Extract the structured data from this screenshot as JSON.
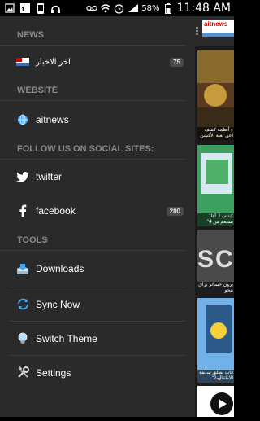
{
  "status_bar": {
    "battery_percent": "58%",
    "time": "11:48 AM",
    "left_icons": [
      "image-icon",
      "ait-icon",
      "phone-icon",
      "headphones-icon"
    ],
    "right_icons": [
      "voicemail-icon",
      "wifi-icon",
      "alarm-icon",
      "signal-icon",
      "battery-icon"
    ]
  },
  "drawer": {
    "sections": [
      {
        "header": "NEWS",
        "items": [
          {
            "label": "اخر الاخبار",
            "icon": "aitnews-logo-icon",
            "badge": "75"
          }
        ]
      },
      {
        "header": "WEBSITE",
        "items": [
          {
            "label": "aitnews",
            "icon": "globe-icon",
            "badge": ""
          }
        ]
      },
      {
        "header": "FOLLOW US ON SOCIAL SITES:",
        "items": [
          {
            "label": "twitter",
            "icon": "twitter-icon",
            "badge": ""
          },
          {
            "label": "facebook",
            "icon": "facebook-icon",
            "badge": "200"
          }
        ]
      },
      {
        "header": "TOOLS",
        "items": [
          {
            "label": "Downloads",
            "icon": "downloads-icon",
            "badge": ""
          },
          {
            "label": "Sync Now",
            "icon": "sync-icon",
            "badge": ""
          },
          {
            "label": "Switch Theme",
            "icon": "lightbulb-icon",
            "badge": ""
          },
          {
            "label": "Settings",
            "icon": "settings-icon",
            "badge": ""
          }
        ]
      }
    ]
  },
  "content": {
    "logo_text": "aitnews",
    "cards": [
      {
        "caption": "ء أنظمة كشف اعن لعبة الأكشن"
      },
      {
        "caption": "كشف ا. أقا\" يستعم س 4\""
      },
      {
        "caption": "يرون خسائر براق بنحو"
      },
      {
        "caption": "قات تطلق سابقة الأطفال 2\""
      }
    ]
  },
  "colors": {
    "drawer_bg": "#2a2a2a",
    "header_text": "#8a8a8a",
    "accent_blue": "#3fa9f5"
  }
}
